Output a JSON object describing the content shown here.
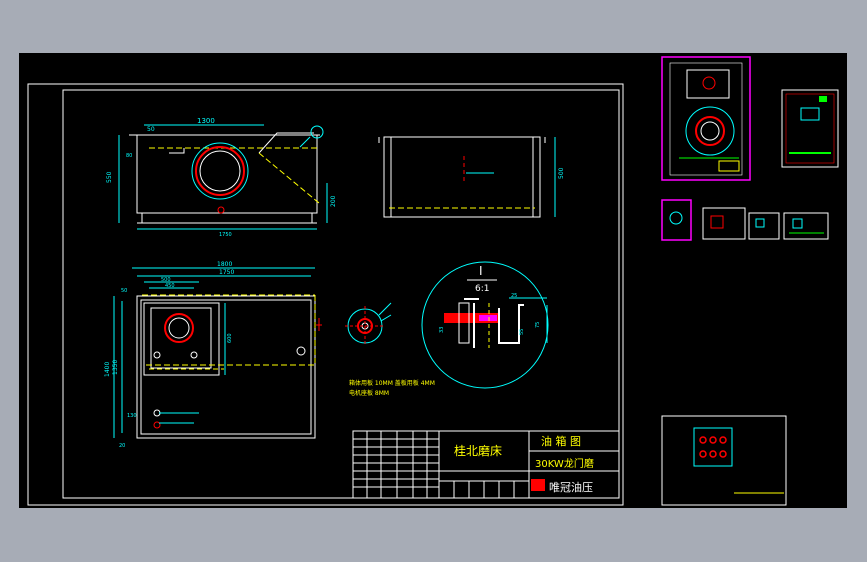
{
  "colors": {
    "background": "#000000",
    "outer": "#a7acb6",
    "frame": "#ffffff",
    "cyan": "#00ffff",
    "yellow": "#ffff00",
    "green": "#00ff00",
    "red": "#ff0000",
    "magenta": "#ff00ff"
  },
  "dims": {
    "top_length": "1300",
    "top_offset": "50",
    "top_height": "550",
    "top_right_h": "200",
    "top_bottom_l": "1750",
    "top_corner": "80",
    "side_height": "500",
    "plan_w1": "1800",
    "plan_w2": "1750",
    "plan_left_h1": "1400",
    "plan_left_h2": "1350",
    "plan_500": "500",
    "plan_450": "450",
    "plan_600": "600",
    "plan_50": "50",
    "plan_20": "20",
    "plan_130": "130",
    "section_25": "25",
    "section_75": "75",
    "section_55": "55",
    "section_33": "33"
  },
  "detail": {
    "label_top": "I",
    "label_bottom": "6:1"
  },
  "notes": {
    "line1": "箱体用板 10MM 盖板用板 4MM",
    "line2": "电机座板 8MM"
  },
  "title_block": {
    "company": "桂北磨床",
    "drawing_name": "油 箱 图",
    "model": "30KW龙门磨",
    "maker": "唯冠油压"
  }
}
